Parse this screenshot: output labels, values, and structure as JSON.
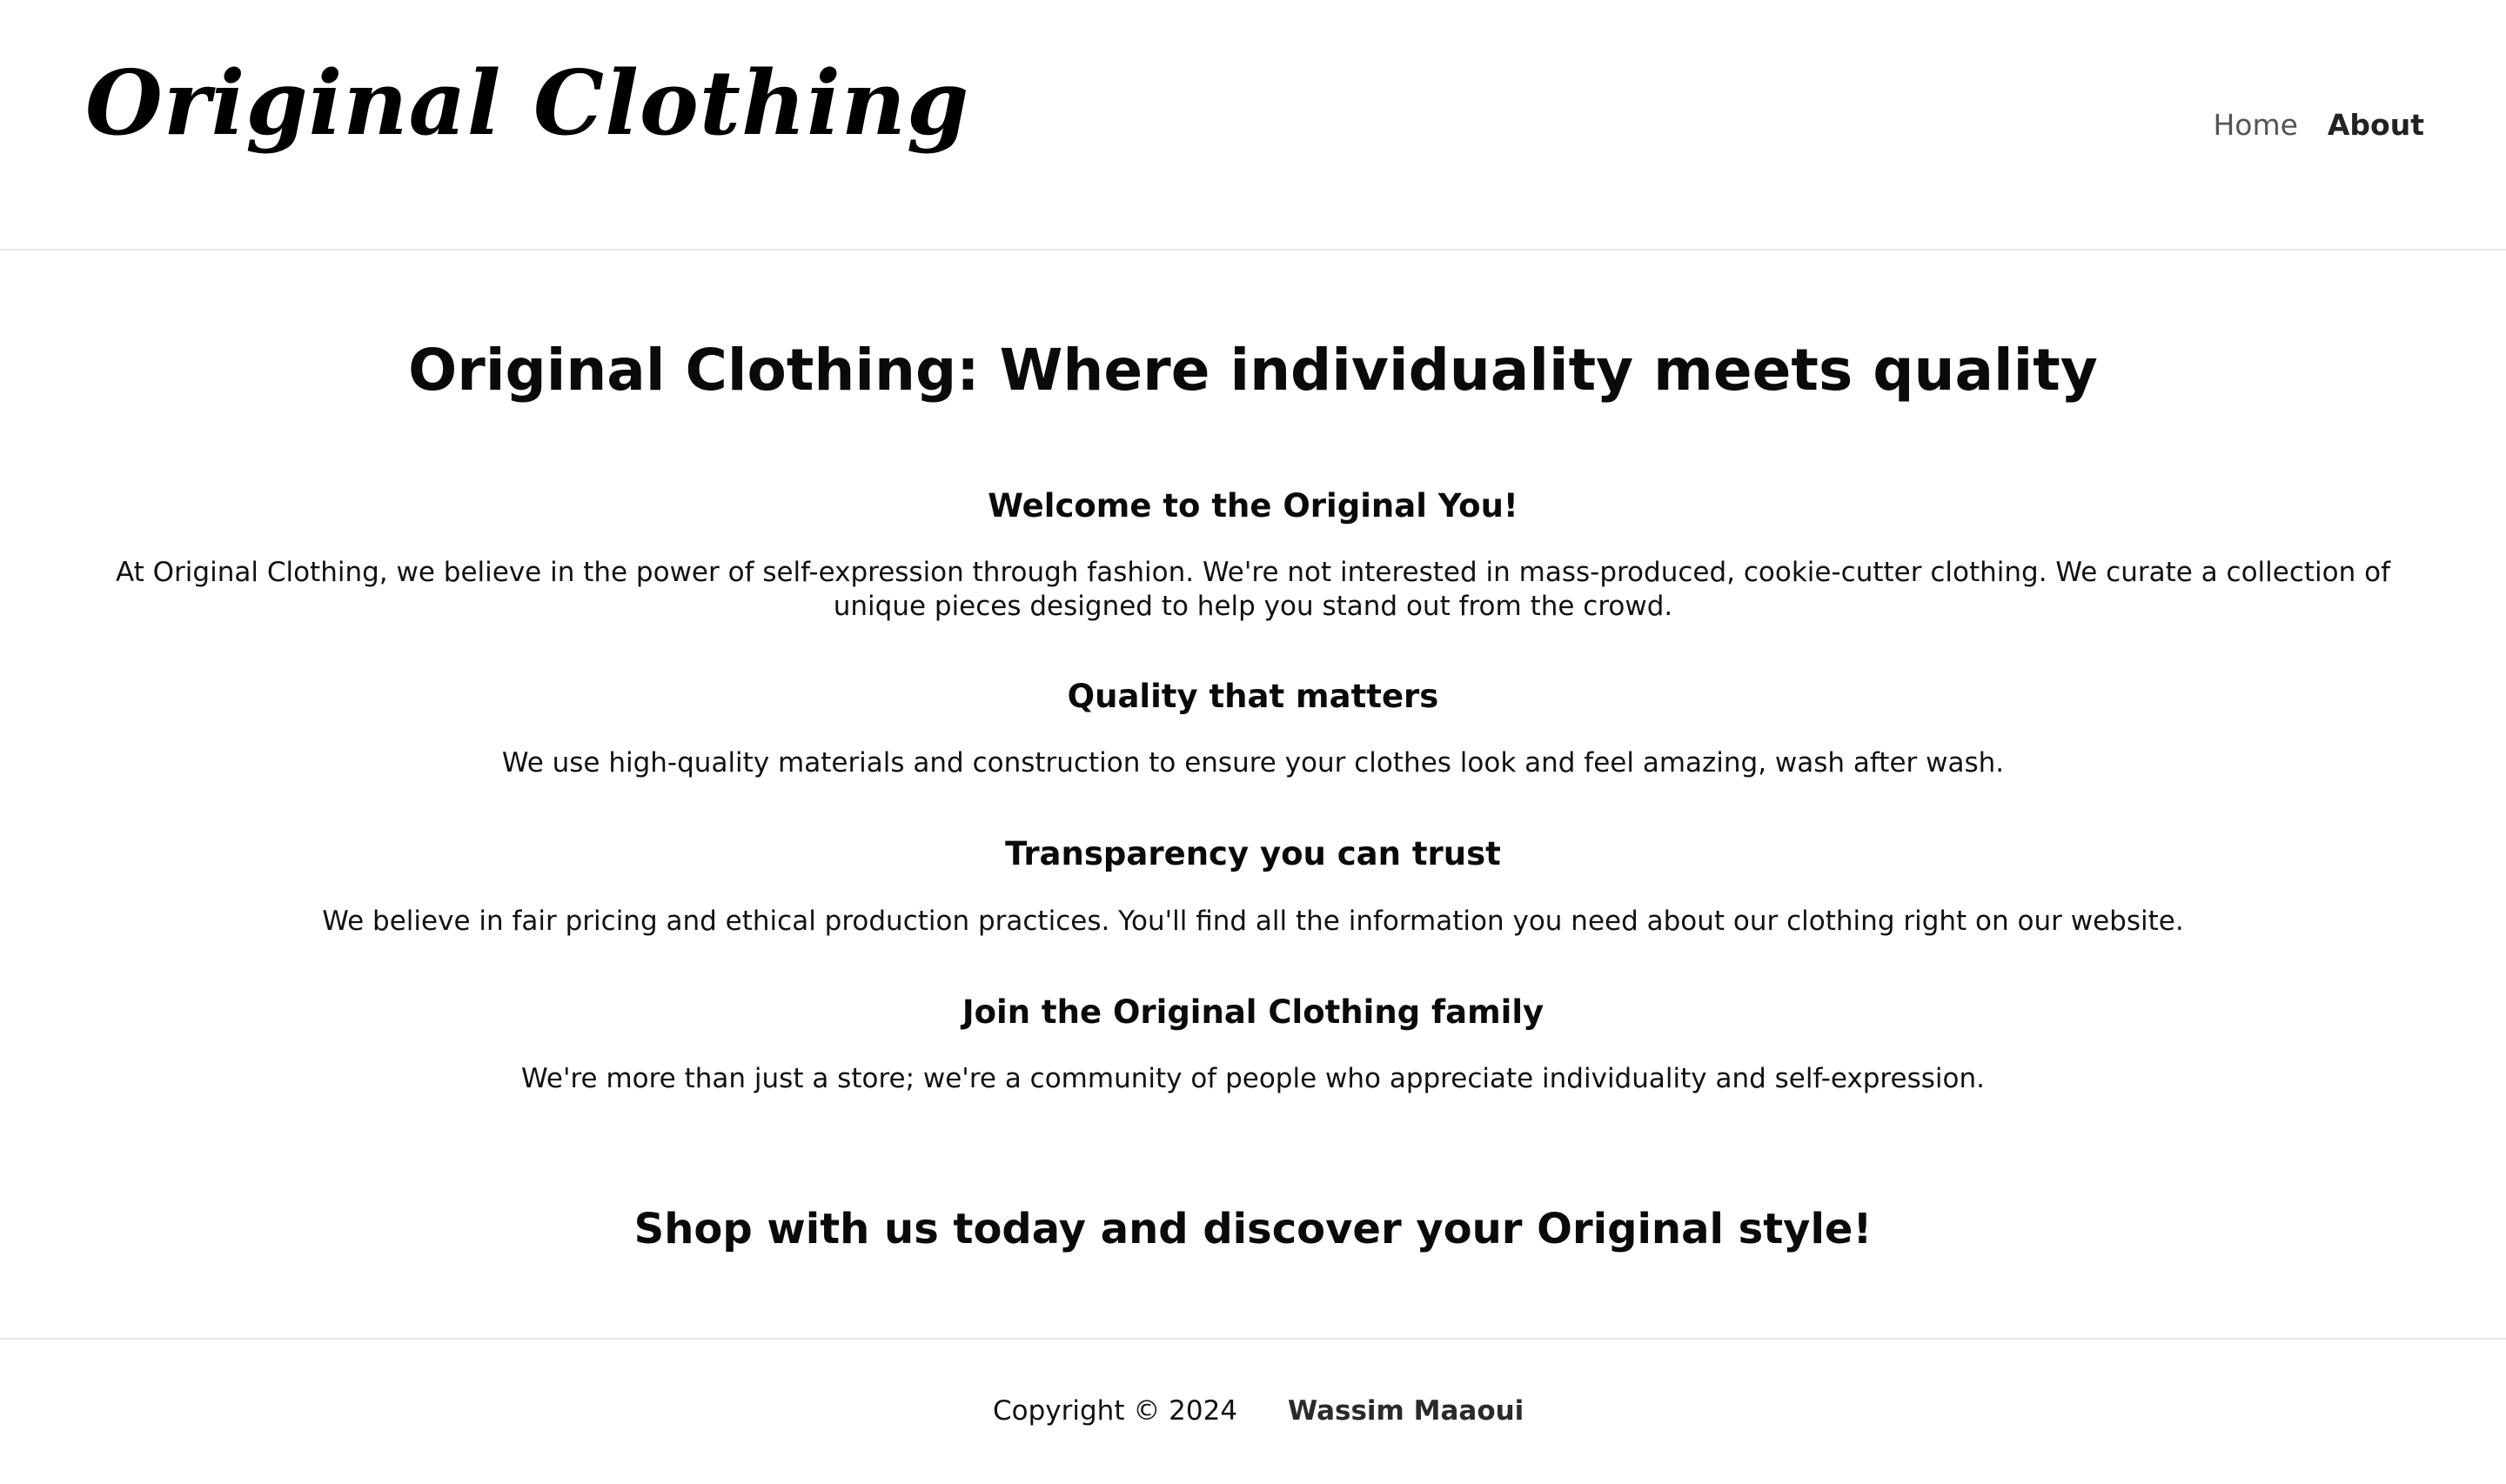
{
  "header": {
    "logo": "Original Clothing",
    "nav": {
      "home_label": "Home",
      "about_label": "About"
    }
  },
  "main": {
    "title": "Original Clothing: Where individuality meets quality",
    "sections": [
      {
        "heading": "Welcome to the Original You!",
        "text": "At Original Clothing, we believe in the power of self-expression through fashion. We're not interested in mass-produced, cookie-cutter clothing. We curate a collection of unique pieces designed to help you stand out from the crowd."
      },
      {
        "heading": "Quality that matters",
        "text": "We use high-quality materials and construction to ensure your clothes look and feel amazing, wash after wash."
      },
      {
        "heading": "Transparency you can trust",
        "text": "We believe in fair pricing and ethical production practices. You'll find all the information you need about our clothing right on our website."
      },
      {
        "heading": "Join the Original Clothing family",
        "text": "We're more than just a store; we're a community of people who appreciate individuality and self-expression."
      }
    ],
    "closing": "Shop with us today and discover your Original style!"
  },
  "footer": {
    "copyright": "Copyright © 2024",
    "author": "Wassim Maaoui"
  },
  "colors": {
    "background": "#ffffff",
    "text": "#111111",
    "nav_inactive": "#555555",
    "divider": "#e6e6e6"
  }
}
